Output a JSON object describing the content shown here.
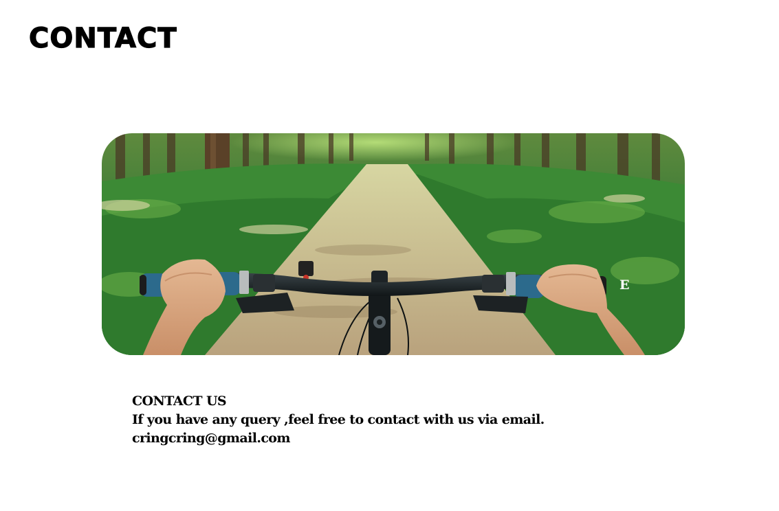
{
  "page": {
    "title": "CONTACT"
  },
  "hero": {
    "image": "forest-trail-bicycle-handlebar-photo",
    "overlay_letter": "E"
  },
  "contact": {
    "heading": "CONTACT US",
    "message": "If you have any query ,feel free to contact with us via email.",
    "email": "cringcring@gmail.com"
  },
  "colors": {
    "background": "#ffffff",
    "text": "#000000",
    "foliage": "#3f8a3a",
    "trail": "#cbbf98"
  }
}
